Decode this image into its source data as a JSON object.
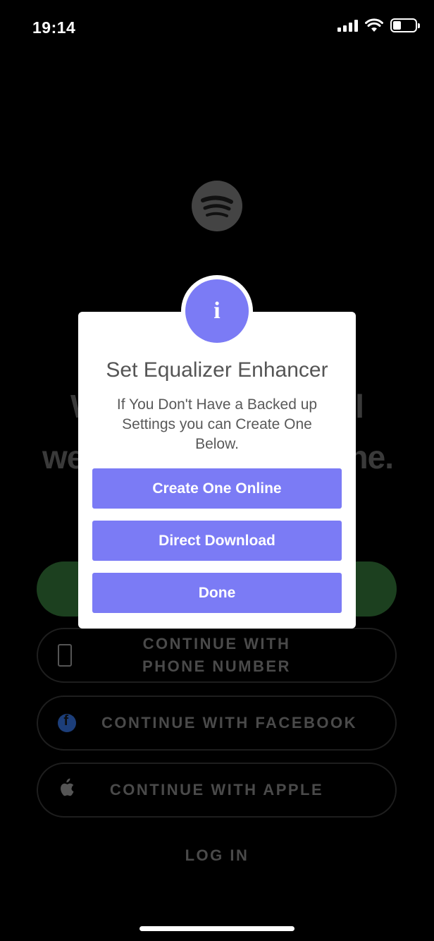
{
  "status_bar": {
    "time": "19:14",
    "signal_icon": "cellular-signal-icon",
    "wifi_icon": "wifi-icon",
    "battery_icon": "battery-icon",
    "battery_level": 0.35
  },
  "background": {
    "logo_icon": "spotify-logo-icon",
    "heading_line1": "W                              l",
    "heading_line2": "we                              ne.",
    "continue_phone": "CONTINUE WITH\nPHONE NUMBER",
    "continue_facebook": "CONTINUE WITH FACEBOOK",
    "continue_apple": "CONTINUE WITH APPLE",
    "login": "LOG IN",
    "phone_icon": "phone-icon",
    "facebook_icon": "facebook-icon",
    "apple_icon": "apple-icon"
  },
  "dialog": {
    "badge_icon": "info-icon",
    "badge_glyph": "i",
    "title": "Set Equalizer Enhancer",
    "message": "If You Don't Have a Backed up Settings you can Create One Below.",
    "buttons": {
      "create": "Create One Online",
      "download": "Direct Download",
      "done": "Done"
    },
    "accent_color": "#7b7bf5"
  }
}
